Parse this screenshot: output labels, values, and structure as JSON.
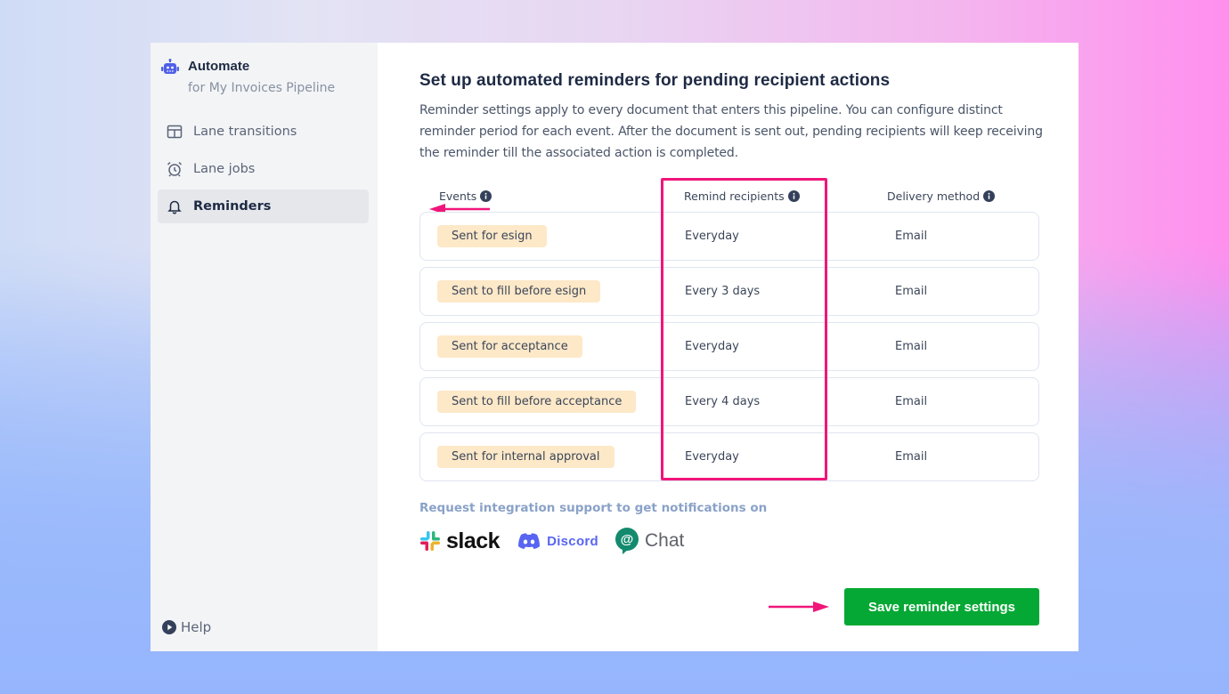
{
  "sidebar": {
    "brand_title": "Automate",
    "brand_subtitle": "for My Invoices Pipeline",
    "items": [
      {
        "label": "Lane transitions",
        "icon": "layout-icon",
        "active": false
      },
      {
        "label": "Lane jobs",
        "icon": "alarm-clock-icon",
        "active": false
      },
      {
        "label": "Reminders",
        "icon": "bell-icon",
        "active": true
      }
    ],
    "help_label": "Help"
  },
  "main": {
    "title": "Set up automated reminders for pending recipient actions",
    "description": "Reminder settings apply to every document that enters this pipeline. You can configure distinct reminder period for each event. After the document is sent out, pending recipients will keep receiving the reminder till the associated action is completed.",
    "table": {
      "headers": [
        "Events",
        "Remind recipients",
        "Delivery method"
      ],
      "rows": [
        {
          "event": "Sent for esign",
          "remind": "Everyday",
          "delivery": "Email"
        },
        {
          "event": "Sent to fill before esign",
          "remind": "Every 3 days",
          "delivery": "Email"
        },
        {
          "event": "Sent for acceptance",
          "remind": "Everyday",
          "delivery": "Email"
        },
        {
          "event": "Sent to fill before acceptance",
          "remind": "Every 4 days",
          "delivery": "Email"
        },
        {
          "event": "Sent for internal approval",
          "remind": "Everyday",
          "delivery": "Email"
        }
      ]
    },
    "integration_label": "Request integration support to get notifications on",
    "integrations": {
      "slack": "slack",
      "discord": "Discord",
      "chat": "Chat"
    },
    "save_label": "Save reminder settings"
  },
  "colors": {
    "accent_green": "#05a834",
    "highlight_pink": "#f0157a",
    "tag_bg": "#fde8c8",
    "brand_icon": "#4f5fe8"
  }
}
